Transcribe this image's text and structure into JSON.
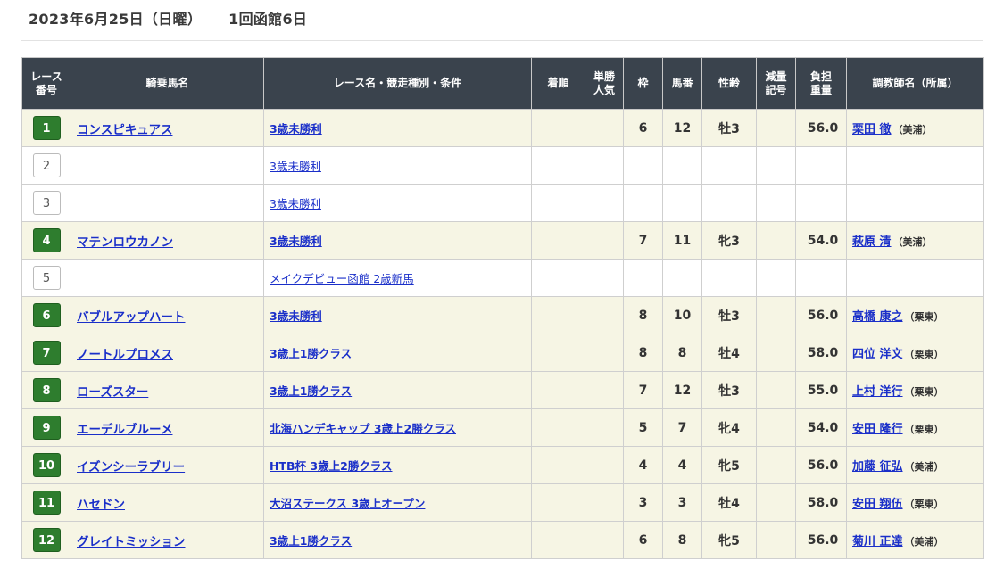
{
  "header": {
    "date": "2023年6月25日（日曜）",
    "meeting": "1回函館6日"
  },
  "columns": {
    "race_no": [
      "レース",
      "番号"
    ],
    "horse": "騎乗馬名",
    "race_name": "レース名・競走種別・条件",
    "finish": "着順",
    "popularity": [
      "単勝",
      "人気"
    ],
    "frame": "枠",
    "horse_no": "馬番",
    "sex_age": "性齢",
    "weight_allow": [
      "減量",
      "記号"
    ],
    "weight": [
      "負担",
      "重量"
    ],
    "trainer": "調教師名（所属）"
  },
  "rows": [
    {
      "race": "1",
      "active": true,
      "horse": "コンスピキュアス",
      "race_name": "3歳未勝利",
      "finish": "",
      "popularity": "",
      "frame": "6",
      "horse_no": "12",
      "sex_age": "牡3",
      "allow": "",
      "weight": "56.0",
      "trainer": "栗田 徹",
      "affiliation": "（美浦）"
    },
    {
      "race": "2",
      "active": false,
      "horse": "",
      "race_name": "3歳未勝利",
      "finish": "",
      "popularity": "",
      "frame": "",
      "horse_no": "",
      "sex_age": "",
      "allow": "",
      "weight": "",
      "trainer": "",
      "affiliation": ""
    },
    {
      "race": "3",
      "active": false,
      "horse": "",
      "race_name": "3歳未勝利",
      "finish": "",
      "popularity": "",
      "frame": "",
      "horse_no": "",
      "sex_age": "",
      "allow": "",
      "weight": "",
      "trainer": "",
      "affiliation": ""
    },
    {
      "race": "4",
      "active": true,
      "horse": "マテンロウカノン",
      "race_name": "3歳未勝利",
      "finish": "",
      "popularity": "",
      "frame": "7",
      "horse_no": "11",
      "sex_age": "牝3",
      "allow": "",
      "weight": "54.0",
      "trainer": "萩原 清",
      "affiliation": "（美浦）"
    },
    {
      "race": "5",
      "active": false,
      "horse": "",
      "race_name": "メイクデビュー函館 2歳新馬",
      "finish": "",
      "popularity": "",
      "frame": "",
      "horse_no": "",
      "sex_age": "",
      "allow": "",
      "weight": "",
      "trainer": "",
      "affiliation": ""
    },
    {
      "race": "6",
      "active": true,
      "horse": "バブルアップハート",
      "race_name": "3歳未勝利",
      "finish": "",
      "popularity": "",
      "frame": "8",
      "horse_no": "10",
      "sex_age": "牡3",
      "allow": "",
      "weight": "56.0",
      "trainer": "高橋 康之",
      "affiliation": "（栗東）"
    },
    {
      "race": "7",
      "active": true,
      "horse": "ノートルプロメス",
      "race_name": "3歳上1勝クラス",
      "finish": "",
      "popularity": "",
      "frame": "8",
      "horse_no": "8",
      "sex_age": "牡4",
      "allow": "",
      "weight": "58.0",
      "trainer": "四位 洋文",
      "affiliation": "（栗東）"
    },
    {
      "race": "8",
      "active": true,
      "horse": "ローズスター",
      "race_name": "3歳上1勝クラス",
      "finish": "",
      "popularity": "",
      "frame": "7",
      "horse_no": "12",
      "sex_age": "牡3",
      "allow": "",
      "weight": "55.0",
      "trainer": "上村 洋行",
      "affiliation": "（栗東）"
    },
    {
      "race": "9",
      "active": true,
      "horse": "エーデルブルーメ",
      "race_name": "北海ハンデキャップ 3歳上2勝クラス",
      "finish": "",
      "popularity": "",
      "frame": "5",
      "horse_no": "7",
      "sex_age": "牝4",
      "allow": "",
      "weight": "54.0",
      "trainer": "安田 隆行",
      "affiliation": "（栗東）"
    },
    {
      "race": "10",
      "active": true,
      "horse": "イズンシーラブリー",
      "race_name": "HTB杯 3歳上2勝クラス",
      "finish": "",
      "popularity": "",
      "frame": "4",
      "horse_no": "4",
      "sex_age": "牝5",
      "allow": "",
      "weight": "56.0",
      "trainer": "加藤 征弘",
      "affiliation": "（美浦）"
    },
    {
      "race": "11",
      "active": true,
      "horse": "ハセドン",
      "race_name": "大沼ステークス 3歳上オープン",
      "finish": "",
      "popularity": "",
      "frame": "3",
      "horse_no": "3",
      "sex_age": "牡4",
      "allow": "",
      "weight": "58.0",
      "trainer": "安田 翔伍",
      "affiliation": "（栗東）"
    },
    {
      "race": "12",
      "active": true,
      "horse": "グレイトミッション",
      "race_name": "3歳上1勝クラス",
      "finish": "",
      "popularity": "",
      "frame": "6",
      "horse_no": "8",
      "sex_age": "牝5",
      "allow": "",
      "weight": "56.0",
      "trainer": "菊川 正達",
      "affiliation": "（美浦）"
    }
  ],
  "colors": {
    "header_bg": "#3a434d",
    "active_row_bg": "#f6f5e4",
    "race_badge_active": "#2e7d2e",
    "link": "#1a2fc9"
  }
}
